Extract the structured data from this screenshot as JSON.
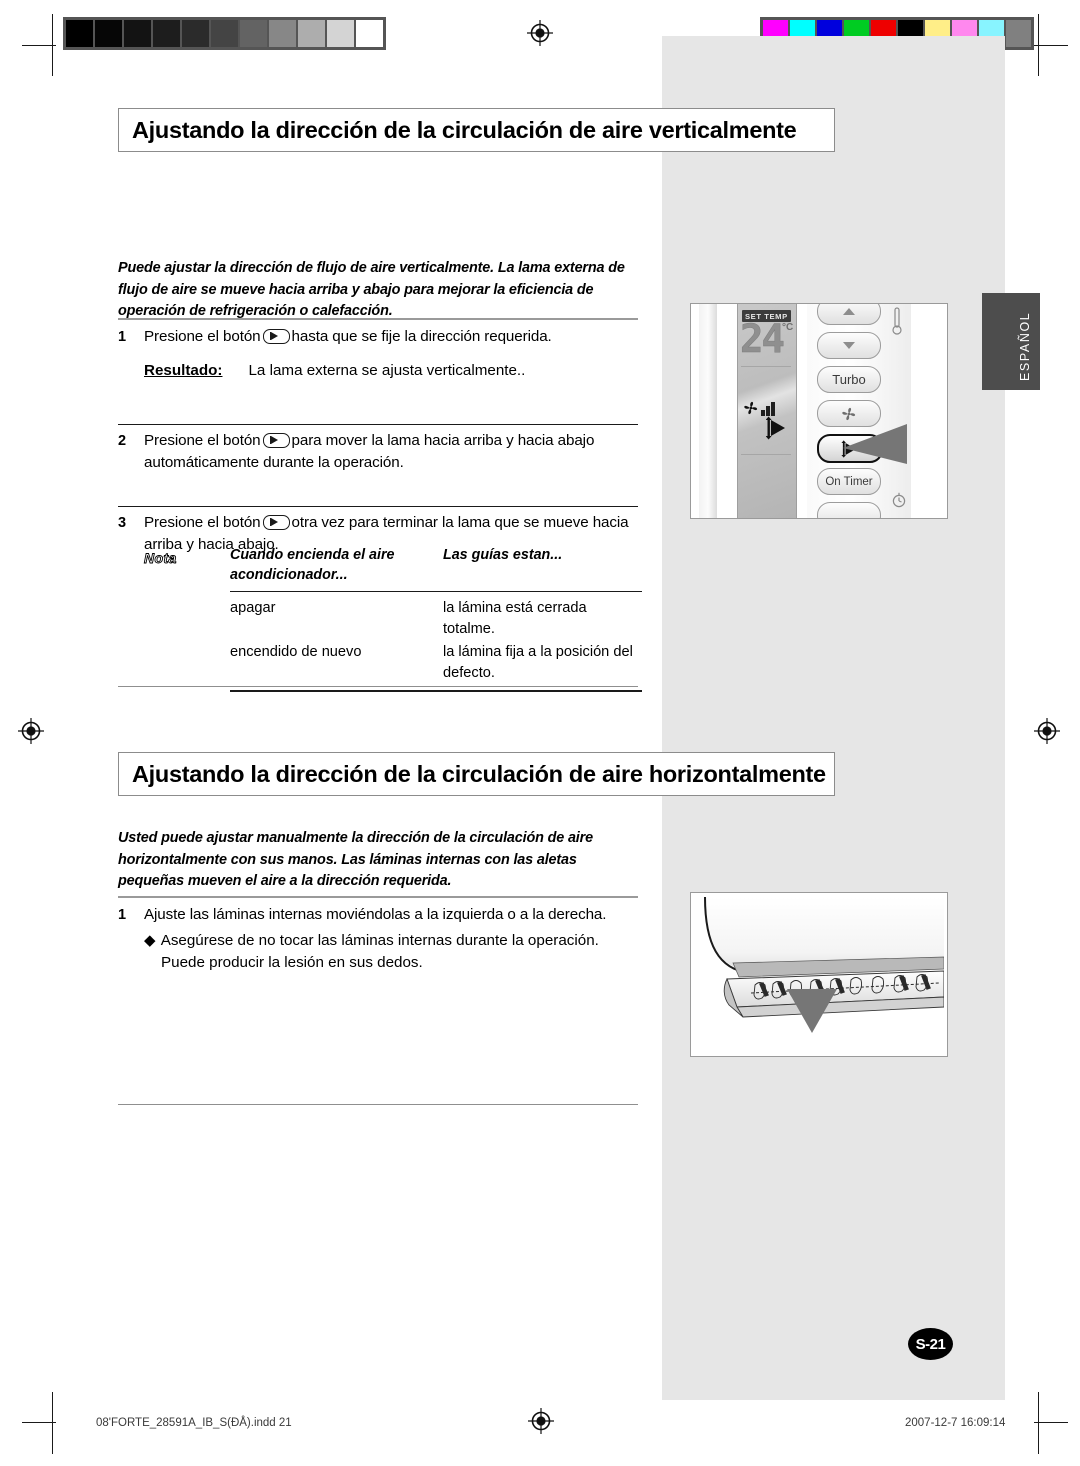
{
  "document": {
    "language_tab": "ESPAÑOL",
    "page_badge": "S-21",
    "footer_left": "08'FORTE_28591A_IB_S(ĐÅ).indd   21",
    "footer_right": "2007-12-7   16:09:14"
  },
  "sections": [
    {
      "title": "Ajustando la dirección de la circulación de aire verticalmente",
      "intro": "Puede ajustar la dirección de flujo de aire verticalmente. La lama externa de flujo de aire se mueve hacia arriba y abajo para mejorar la eficiencia de operación de refrigeración o calefacción.",
      "steps": [
        {
          "number": "1",
          "text_before": "Presione el botón",
          "text_after": "hasta que se fije la dirección requerida.",
          "result_label": "Resultado:",
          "result_value": "La lama externa se ajusta verticalmente.."
        },
        {
          "number": "2",
          "text_before": "Presione el botón",
          "text_after": "para mover la lama hacia arriba y hacia abajo",
          "line2": "automáticamente durante la operación."
        },
        {
          "number": "3",
          "text_before": "Presione el botón",
          "text_after": "otra vez para terminar la lama que se mueve hacia",
          "line2": "arriba y hacia abajo."
        }
      ],
      "note": {
        "label": "Nota",
        "headers": [
          "Cuando encienda el aire acondicionador...",
          "Las guías estan..."
        ],
        "rows": [
          [
            "apagar",
            "la lámina está cerrada totalme."
          ],
          [
            "encendido de nuevo",
            "la lámina fija a la posición del defecto."
          ]
        ]
      }
    },
    {
      "title": "Ajustando la dirección de la circulación de aire horizontalmente",
      "intro": "Usted puede ajustar manualmente la dirección de la circulación de aire horizontalmente con sus manos. Las láminas internas con las aletas pequeñas mueven el aire a la dirección requerida.",
      "steps": [
        {
          "number": "1",
          "text": "Ajuste las láminas internas moviéndolas a la izquierda o a la derecha."
        }
      ],
      "bullets": [
        {
          "marker": "◆",
          "line1": "Asegúrese de no tocar las láminas internas durante la operación.",
          "line2": "Puede producir la lesión en sus dedos."
        }
      ]
    }
  ],
  "illustrations": {
    "remote": {
      "lcd": {
        "set_temp_label": "SET TEMP",
        "temperature": "24",
        "unit": "°C"
      },
      "buttons": [
        {
          "name": "temp-up",
          "label": ""
        },
        {
          "name": "temp-down",
          "label": ""
        },
        {
          "name": "turbo",
          "label": "Turbo"
        },
        {
          "name": "fan-speed",
          "label": ""
        },
        {
          "name": "airflow-direction",
          "label": ""
        },
        {
          "name": "on-timer",
          "label": "On Timer"
        }
      ]
    }
  },
  "print_marks": {
    "grayscale_patches": [
      "#000000",
      "#060606",
      "#131313",
      "#1d1d1d",
      "#2b2b2b",
      "#444444",
      "#636363",
      "#878787",
      "#adadad",
      "#d4d4d4",
      "#ffffff"
    ],
    "color_patches": [
      "#ff00ff",
      "#00ffff",
      "#0000dd",
      "#00cc22",
      "#ee0000",
      "#000000",
      "#ffee88",
      "#ff88ee",
      "#88f4ff",
      "#808080"
    ]
  }
}
